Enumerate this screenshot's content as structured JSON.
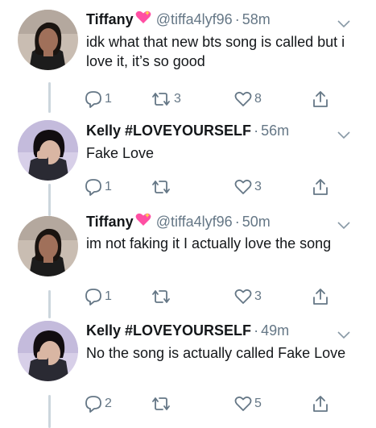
{
  "colors": {
    "text": "#14171a",
    "muted": "#657786",
    "line": "#ccd6dd"
  },
  "tweets": [
    {
      "name": "Tiffany",
      "emoji": "pink-sparkle-heart",
      "handle": "@tiffa4lyf96",
      "time": "58m",
      "text": "idk what that new bts song is called but i love it, it’s so good",
      "replies": "1",
      "retweets": "3",
      "likes": "8"
    },
    {
      "name": "Kelly #LOVEYOURSELF",
      "emoji": "",
      "handle": "",
      "time": "56m",
      "text": "Fake Love",
      "replies": "1",
      "retweets": "",
      "likes": "3"
    },
    {
      "name": "Tiffany",
      "emoji": "pink-sparkle-heart",
      "handle": "@tiffa4lyf96",
      "time": "50m",
      "text": "im not faking it I actually love the song",
      "replies": "1",
      "retweets": "",
      "likes": "3"
    },
    {
      "name": "Kelly #LOVEYOURSELF",
      "emoji": "",
      "handle": "",
      "time": "49m",
      "text": "No the song is actually called Fake Love",
      "replies": "2",
      "retweets": "",
      "likes": "5"
    }
  ]
}
